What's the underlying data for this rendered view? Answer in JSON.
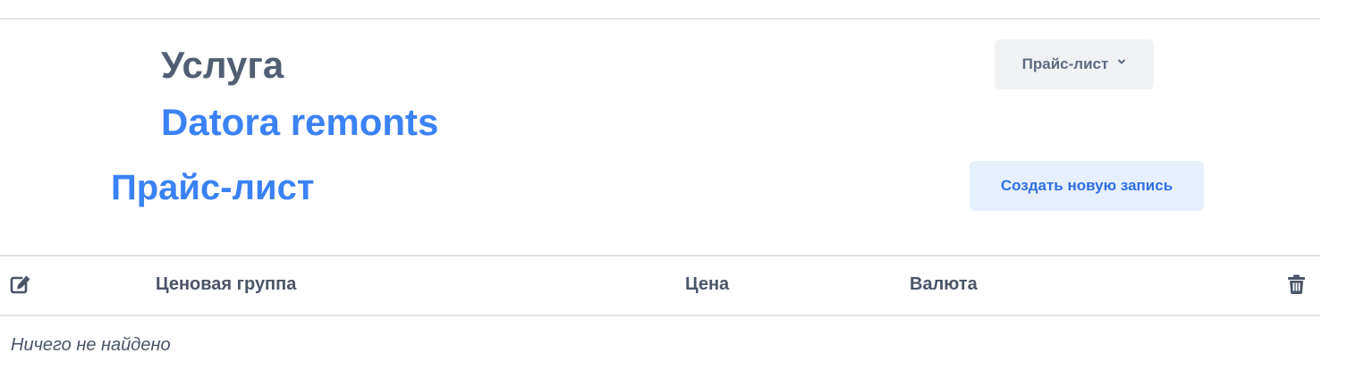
{
  "header": {
    "entity_label": "Услуга",
    "entity_name": "Datora remonts",
    "section_title": "Прайс-лист"
  },
  "toolbar": {
    "dropdown_label": "Прайс-лист",
    "dropdown_icon": "chevron-down-icon",
    "create_label": "Создать новую запись"
  },
  "table": {
    "edit_icon": "edit-icon",
    "columns": [
      "Ценовая группа",
      "Цена",
      "Валюта"
    ],
    "delete_icon": "trash-icon",
    "rows": [],
    "empty_text": "Ничего не найдено"
  },
  "colors": {
    "accent": "#3b82f6",
    "heading": "#525f73",
    "text": "#4a5568",
    "divider": "#e2e5ea",
    "button_secondary_bg": "#f1f2f4",
    "button_primary_bg": "#e6f0fd"
  }
}
